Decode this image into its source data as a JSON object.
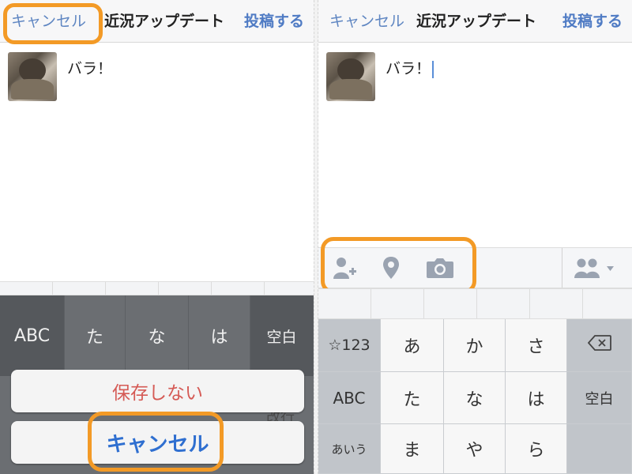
{
  "left": {
    "navbar": {
      "cancel": "キャンセル",
      "title": "近況アップデート",
      "post": "投稿する"
    },
    "post": {
      "text": "バラ！"
    },
    "keyboard": {
      "keys": [
        "ABC",
        "た",
        "な",
        "は",
        "空白"
      ]
    },
    "sheet": {
      "dont_save": "保存しない",
      "cancel": "キャンセル"
    },
    "partial_key": "改行"
  },
  "right": {
    "navbar": {
      "cancel": "キャンセル",
      "title": "近況アップデート",
      "post": "投稿する"
    },
    "post": {
      "text": "バラ！"
    },
    "toolbar": {
      "icons": [
        "tag-friend-icon",
        "location-pin-icon",
        "camera-icon",
        "audience-friends-icon"
      ]
    },
    "keyboard": {
      "rows": [
        [
          "☆123",
          "あ",
          "か",
          "さ",
          ""
        ],
        [
          "ABC",
          "た",
          "な",
          "は",
          "空白"
        ],
        [
          "あいう",
          "ま",
          "や",
          "ら",
          ""
        ]
      ]
    }
  },
  "colors": {
    "highlight": "#f39a26",
    "link": "#4f7bc4",
    "destructive": "#d55a55"
  }
}
